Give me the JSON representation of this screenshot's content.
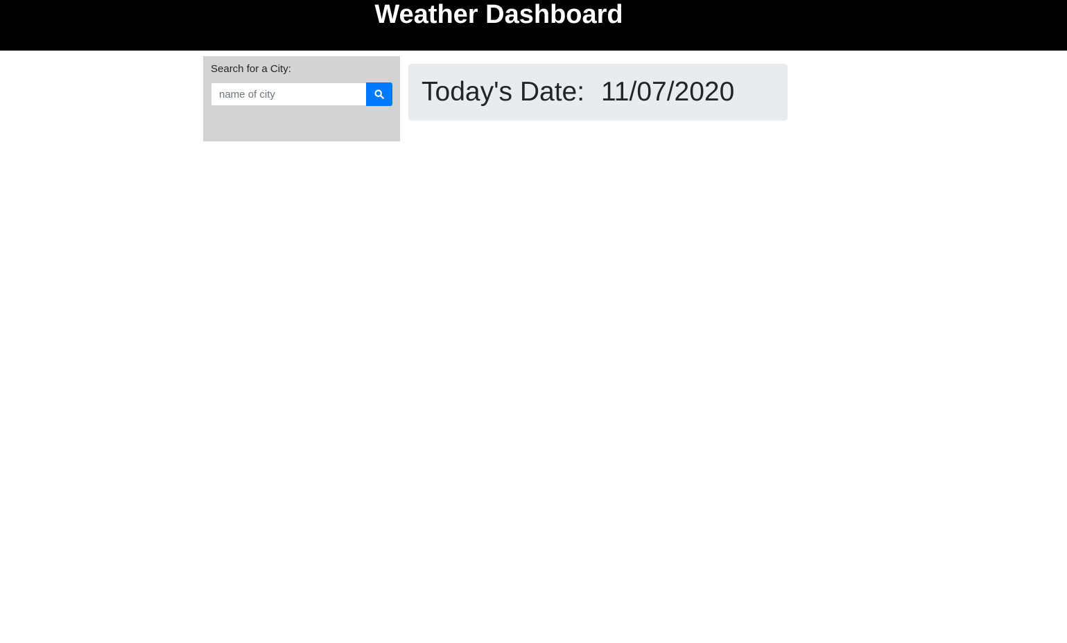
{
  "header": {
    "title": "Weather Dashboard"
  },
  "search": {
    "label": "Search for a City:",
    "placeholder": "name of city",
    "value": "",
    "button_icon": "search-icon"
  },
  "date_card": {
    "label": "Today's Date:",
    "value": "11/07/2020"
  },
  "colors": {
    "header_bg": "#000000",
    "panel_bg": "#d3d3d3",
    "button_bg": "#007bff",
    "card_bg": "#e9ecef"
  }
}
